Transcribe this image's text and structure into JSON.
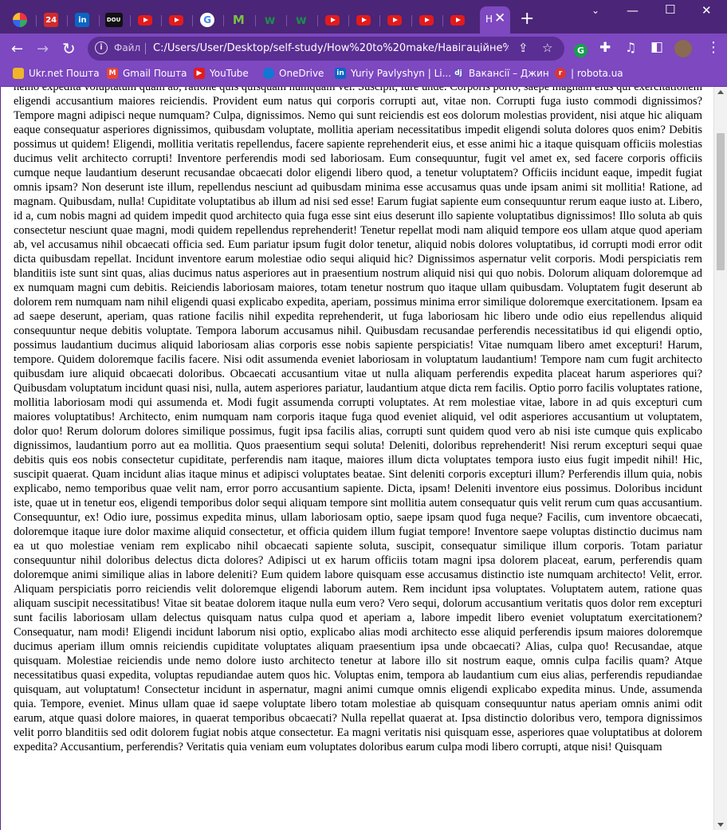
{
  "tabs": [
    {
      "icon": "pinwheel-icon",
      "short": "",
      "color": "#7c3aed"
    },
    {
      "icon": "news24-icon",
      "short": "24",
      "color": "#d12c2c"
    },
    {
      "icon": "linkedin-icon",
      "short": "in",
      "color": "#0a66c2"
    },
    {
      "icon": "dou-icon",
      "short": "DOU",
      "color": "#111111"
    },
    {
      "icon": "youtube-icon",
      "short": "",
      "color": "#e31b1b"
    },
    {
      "icon": "youtube-icon",
      "short": "",
      "color": "#e31b1b"
    },
    {
      "icon": "google-icon",
      "short": "G",
      "color": "#ffffff"
    },
    {
      "icon": "m-logo-icon",
      "short": "M",
      "color": "#7ac142"
    },
    {
      "icon": "w-logo-icon",
      "short": "w",
      "color": "#1f8a4c"
    },
    {
      "icon": "w-logo-icon",
      "short": "w",
      "color": "#1f8a4c"
    },
    {
      "icon": "youtube-icon",
      "short": "",
      "color": "#e31b1b"
    },
    {
      "icon": "youtube-icon",
      "short": "",
      "color": "#e31b1b"
    },
    {
      "icon": "youtube-icon",
      "short": "",
      "color": "#e31b1b"
    },
    {
      "icon": "youtube-icon",
      "short": "",
      "color": "#e31b1b"
    },
    {
      "icon": "youtube-icon",
      "short": "",
      "color": "#e31b1b"
    }
  ],
  "active_tab": {
    "title": "H",
    "close": "✕"
  },
  "new_tab": "+",
  "window_controls": {
    "minimize": "—",
    "maximize": "☐",
    "close": "✕"
  },
  "toolbar": {
    "back": "←",
    "forward": "→",
    "reload": "↻",
    "info_glyph": "i",
    "scheme_label": "Файл",
    "url": "C:/Users/User/Desktop/self-study/How%20to%20make/Навігаційне%..."
  },
  "bookmarks": [
    {
      "label": "Ukr.net Пошта",
      "icon": "ukrnet-icon",
      "color": "#f0b429"
    },
    {
      "label": "Gmail Пошта",
      "icon": "gmail-icon",
      "color": "#ea4335"
    },
    {
      "label": "YouTube",
      "icon": "youtube-icon",
      "color": "#e31b1b"
    },
    {
      "label": "OneDrive",
      "icon": "onedrive-icon",
      "color": "#0f78d4"
    },
    {
      "label": "Yuriy Pavlyshyn | Li...",
      "icon": "linkedin-icon",
      "color": "#0a66c2"
    },
    {
      "label": "Вакансії – Джин",
      "icon": "djinni-icon",
      "color": "#6b4fbb"
    },
    {
      "label": "| robota.ua",
      "icon": "robota-icon",
      "color": "#d93636"
    }
  ],
  "page": {
    "text": "nemo expedita voluptatum quam ab, ratione quis quisquam numquam vel. Suscipit, iure unde. Corporis porro, saepe magnam eius qui exercitationem eligendi accusantium maiores reiciendis. Provident eum natus qui corporis corrupti aut, vitae non. Corrupti fuga iusto commodi dignissimos? Tempore magni adipisci neque numquam? Culpa, dignissimos. Nemo qui sunt reiciendis est eos dolorum molestias provident, nisi atque hic aliquam eaque consequatur asperiores dignissimos, quibusdam voluptate, mollitia aperiam necessitatibus impedit eligendi soluta dolores quos enim? Debitis possimus ut quidem! Eligendi, mollitia veritatis repellendus, facere sapiente reprehenderit eius, et esse animi hic a itaque quisquam officiis molestias ducimus velit architecto corrupti! Inventore perferendis modi sed laboriosam. Eum consequuntur, fugit vel amet ex, sed facere corporis officiis cumque neque laudantium deserunt recusandae obcaecati dolor eligendi libero quod, a tenetur voluptatem? Officiis incidunt eaque, impedit fugiat omnis ipsam? Non deserunt iste illum, repellendus nesciunt ad quibusdam minima esse accusamus quas unde ipsam animi sit mollitia! Ratione, ad magnam. Quibusdam, nulla! Cupiditate voluptatibus ab illum ad nisi sed esse! Earum fugiat sapiente eum consequuntur rerum eaque iusto at. Libero, id a, cum nobis magni ad quidem impedit quod architecto quia fuga esse sint eius deserunt illo sapiente voluptatibus dignissimos! Illo soluta ab quis consectetur nesciunt quae magni, modi quidem repellendus reprehenderit! Tenetur repellat modi nam aliquid tempore eos ullam atque quod aperiam ab, vel accusamus nihil obcaecati officia sed. Eum pariatur ipsum fugit dolor tenetur, aliquid nobis dolores voluptatibus, id corrupti modi error odit dicta quibusdam repellat. Incidunt inventore earum molestiae odio sequi aliquid hic? Dignissimos aspernatur velit corporis. Modi perspiciatis rem blanditiis iste sunt sint quas, alias ducimus natus asperiores aut in praesentium nostrum aliquid nisi qui quo nobis. Dolorum aliquam doloremque ad ex numquam magni cum debitis. Reiciendis laboriosam maiores, totam tenetur nostrum quo itaque ullam quibusdam. Voluptatem fugit deserunt ab dolorem rem numquam nam nihil eligendi quasi explicabo expedita, aperiam, possimus minima error similique doloremque exercitationem. Ipsam ea ad saepe deserunt, aperiam, quas ratione facilis nihil expedita reprehenderit, ut fuga laboriosam hic libero unde odio eius repellendus aliquid consequuntur neque debitis voluptate. Tempora laborum accusamus nihil. Quibusdam recusandae perferendis necessitatibus id qui eligendi optio, possimus laudantium ducimus aliquid laboriosam alias corporis esse nobis sapiente perspiciatis! Vitae numquam libero amet excepturi! Harum, tempore. Quidem doloremque facilis facere. Nisi odit assumenda eveniet laboriosam in voluptatum laudantium! Tempore nam cum fugit architecto quibusdam iure aliquid obcaecati doloribus. Obcaecati accusantium vitae ut nulla aliquam perferendis expedita placeat harum asperiores qui? Quibusdam voluptatum incidunt quasi nisi, nulla, autem asperiores pariatur, laudantium atque dicta rem facilis. Optio porro facilis voluptates ratione, mollitia laboriosam modi qui assumenda et. Modi fugit assumenda corrupti voluptates. At rem molestiae vitae, labore in ad quis excepturi cum maiores voluptatibus! Architecto, enim numquam nam corporis itaque fuga quod eveniet aliquid, vel odit asperiores accusantium ut voluptatem, dolor quo! Rerum dolorum dolores similique possimus, fugit ipsa facilis alias, corrupti sunt quidem quod vero ab nisi iste cumque quis explicabo dignissimos, laudantium porro aut ea mollitia. Quos praesentium sequi soluta! Deleniti, doloribus reprehenderit! Nisi rerum excepturi sequi quae debitis quis eos nobis consectetur cupiditate, perferendis nam itaque, maiores illum dicta voluptates tempora iusto eius fugit impedit nihil! Hic, suscipit quaerat. Quam incidunt alias itaque minus et adipisci voluptates beatae. Sint deleniti corporis excepturi illum? Perferendis illum quia, nobis explicabo, nemo temporibus quae velit nam, error porro accusantium sapiente. Dicta, ipsam! Deleniti inventore eius possimus. Doloribus incidunt iste, quae ut in tenetur eos, eligendi temporibus dolor sequi aliquam tempore sint mollitia autem consequatur quis velit rerum cum quas accusantium. Consequuntur, ex! Odio iure, possimus expedita minus, ullam laboriosam optio, saepe ipsam quod fuga neque? Facilis, cum inventore obcaecati, doloremque itaque iure dolor maxime aliquid consectetur, et officia quidem illum fugiat tempore! Inventore saepe voluptas distinctio ducimus nam ea ut quo molestiae veniam rem explicabo nihil obcaecati sapiente soluta, suscipit, consequatur similique illum corporis. Totam pariatur consequuntur nihil doloribus delectus dicta dolores? Adipisci ut ex harum officiis totam magni ipsa dolorem placeat, earum, perferendis quam doloremque animi similique alias in labore deleniti? Eum quidem labore quisquam esse accusamus distinctio iste numquam architecto! Velit, error. Aliquam perspiciatis porro reiciendis velit doloremque eligendi laborum autem. Rem incidunt ipsa voluptates. Voluptatem autem, ratione quas aliquam suscipit necessitatibus! Vitae sit beatae dolorem itaque nulla eum vero? Vero sequi, dolorum accusantium veritatis quos dolor rem excepturi sunt facilis laboriosam ullam delectus quisquam natus culpa quod et aperiam a, labore impedit libero eveniet voluptatum exercitationem? Consequatur, nam modi! Eligendi incidunt laborum nisi optio, explicabo alias modi architecto esse aliquid perferendis ipsum maiores doloremque ducimus aperiam illum omnis reiciendis cupiditate voluptates aliquam praesentium ipsa unde obcaecati? Alias, culpa quo! Recusandae, atque quisquam. Molestiae reiciendis unde nemo dolore iusto architecto tenetur at labore illo sit nostrum eaque, omnis culpa facilis quam? Atque necessitatibus quasi expedita, voluptas repudiandae autem quos hic. Voluptas enim, tempora ab laudantium cum eius alias, perferendis repudiandae quisquam, aut voluptatum! Consectetur incidunt in aspernatur, magni animi cumque omnis eligendi explicabo expedita minus. Unde, assumenda quia. Tempore, eveniet. Minus ullam quae id saepe voluptate libero totam molestiae ab quisquam consequuntur natus aperiam omnis animi odit earum, atque quasi dolore maiores, in quaerat temporibus obcaecati? Nulla repellat quaerat at. Ipsa distinctio doloribus vero, tempora dignissimos velit porro blanditiis sed odit dolorem fugiat nobis atque consectetur. Ea magni veritatis nisi quisquam esse, asperiores quae voluptatibus at dolorem expedita? Accusantium, perferendis? Veritatis quia veniam eum voluptates doloribus earum culpa modi libero corrupti, atque nisi! Quisquam"
  },
  "colors": {
    "tabstrip": "#4b2577",
    "toolbar": "#7d48c0",
    "omnibox": "#5b2e93"
  }
}
